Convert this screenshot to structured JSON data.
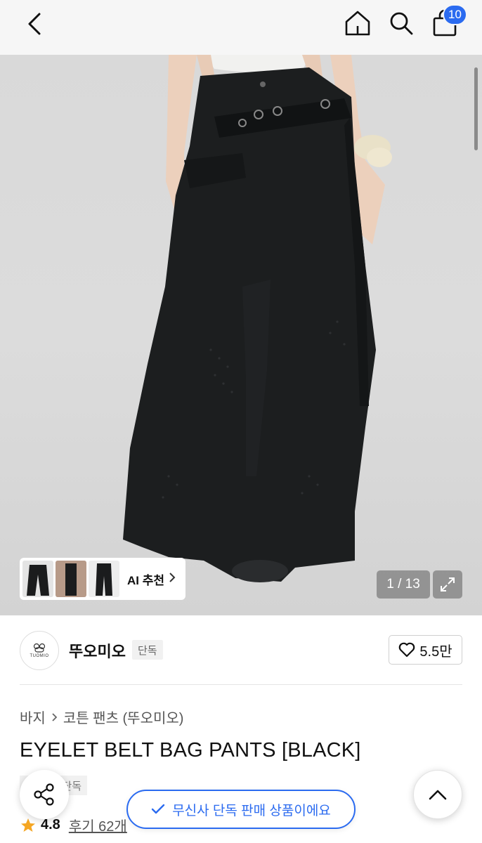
{
  "header": {
    "back_icon": "chevron-left-icon",
    "home_icon": "home-icon",
    "search_icon": "search-icon",
    "cart_icon": "shopping-bag-icon",
    "cart_count": "10"
  },
  "gallery": {
    "ai_recommend_label": "AI 추천",
    "counter": "1 / 13"
  },
  "brand": {
    "logo_text": "TUOMIO",
    "name": "뚜오미오",
    "exclusive_tag": "단독",
    "likes": "5.5만"
  },
  "breadcrumb": {
    "category": "바지",
    "subcategory": "코튼 팬츠 (뚜오미오)"
  },
  "product": {
    "title": "EYELET BELT BAG PANTS [BLACK]",
    "tag": "단독"
  },
  "review": {
    "score": "4.8",
    "label": "후기 62개"
  },
  "notice": {
    "text": "무신사 단독 판매 상품이에요"
  },
  "colors": {
    "accent": "#2b6bf0",
    "star": "#f5a623"
  }
}
